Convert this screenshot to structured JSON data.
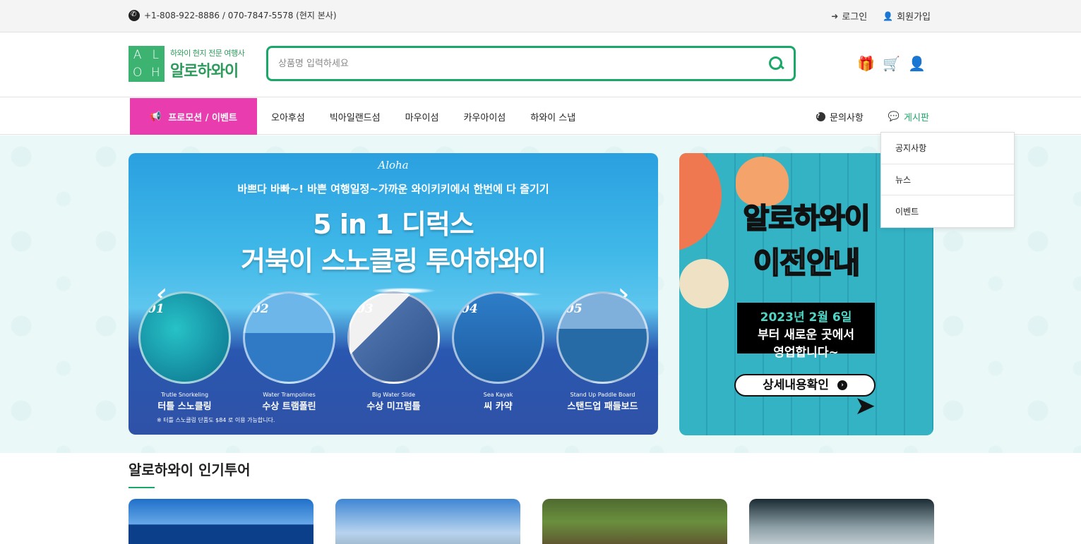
{
  "topbar": {
    "phone": "+1-808-922-8886 / 070-7847-5578 (현지 본사)",
    "login": "로그인",
    "signup": "회원가입"
  },
  "logo": {
    "letters": [
      "A",
      "L",
      "O",
      "H"
    ],
    "sub": "하와이 현지 전문 여행사",
    "main": "알로하와이"
  },
  "search": {
    "placeholder": "상품명 입력하세요"
  },
  "header_icons": [
    "gift-icon",
    "cart-icon",
    "user-icon"
  ],
  "nav": {
    "promo": "프로모션 / 이벤트",
    "items": [
      "오아후섬",
      "빅아일랜드섬",
      "마우이섬",
      "카우아이섬",
      "하와이 스냅"
    ],
    "inquiry": "문의사항",
    "board": "게시판"
  },
  "dropdown": [
    "공지사항",
    "뉴스",
    "이벤트"
  ],
  "banner": {
    "aloha": "Aloha",
    "line1": "바쁘다 바빠~! 바쁜 여행일정~가까운 와이키키에서 한번에 다 즐기기",
    "line2": "5 in 1 디럭스",
    "line3": "거북이 스노클링 투어하와이",
    "items": [
      {
        "num": "01",
        "en": "Trutle Snorkeling",
        "ko": "터틀 스노클링"
      },
      {
        "num": "02",
        "en": "Water Trampolines",
        "ko": "수상 트램폴린"
      },
      {
        "num": "03",
        "en": "Big Water Slide",
        "ko": "수상 미끄럼틀"
      },
      {
        "num": "04",
        "en": "Sea Kayak",
        "ko": "씨 카약"
      },
      {
        "num": "05",
        "en": "Stand Up Paddle Board",
        "ko": "스탠드업 패들보드"
      }
    ],
    "note": "※ 터틀 스노클링 단품도 $84 로 이용 가능합니다."
  },
  "side_banner": {
    "title1": "알로하와이",
    "title2": "이전안내",
    "date": "2023년 2월 6일",
    "line_a": "부터 새로운 곳에서",
    "line_b": "영업합니다~",
    "button": "상세내용확인"
  },
  "section": {
    "title": "알로하와이 인기투어"
  },
  "colors": {
    "accent": "#1aa868",
    "promo": "#e93caf"
  }
}
